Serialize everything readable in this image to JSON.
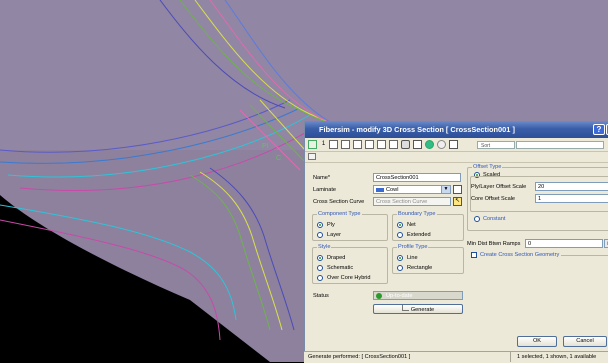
{
  "dialog": {
    "title": "Fibersim - modify 3D Cross Section [ CrossSection001 ]",
    "help_glyph": "?",
    "close_glyph": "x",
    "toolbar_number": "1",
    "sort_label": "Sort",
    "fields": {
      "name_label": "Name*",
      "name_value": "CrossSection001",
      "laminate_label": "Laminate",
      "laminate_value": "Cowl",
      "curve_label": "Cross Section Curve",
      "curve_value": "Cross Section Curve"
    },
    "component_type": {
      "title": "Component Type",
      "options": [
        "Ply",
        "Layer"
      ],
      "selected": 0
    },
    "boundary_type": {
      "title": "Boundary Type",
      "options": [
        "Net",
        "Extended"
      ],
      "selected": 0
    },
    "style": {
      "title": "Style",
      "options": [
        "Draped",
        "Schematic",
        "Over Core Hybrid"
      ],
      "selected": 0
    },
    "profile_type": {
      "title": "Profile Type",
      "options": [
        "Line",
        "Rectangle"
      ],
      "selected": 0
    },
    "offset_type": {
      "title": "Offset Type",
      "scaled_label": "Scaled",
      "ply_scale_label": "Ply/Layer Offset Scale",
      "ply_scale_value": "20",
      "core_scale_label": "Core Offset Scale",
      "core_scale_value": "1",
      "constant_label": "Constant"
    },
    "min_dist_label": "Min Dist Btwn Ramps",
    "min_dist_value": "0",
    "min_dist_unit": "in",
    "create_geometry_label": "Create Cross Section Geometry",
    "status_label": "Status",
    "status_value": "Up-to-date",
    "generate_label": "Generate",
    "ok_label": "OK",
    "cancel_label": "Cancel"
  },
  "statusbar": {
    "message": "Generate performed: [ CrossSection001 ]",
    "selection": "1 selected, 1 shown, 1 available"
  },
  "colors": {
    "viewport_bg": "#8d819e",
    "title_blue": "#3a5ea8",
    "status_green": "#2a9a2a"
  }
}
